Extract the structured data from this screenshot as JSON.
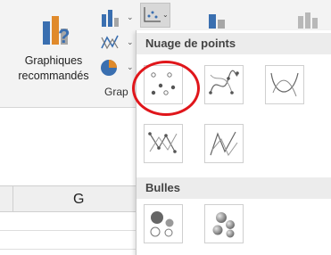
{
  "ribbon": {
    "recommended_label_line1": "Graphiques",
    "recommended_label_line2": "recommandés",
    "group_label": "Grap"
  },
  "dropdown": {
    "scatter_section": "Nuage de points",
    "bubble_section": "Bulles"
  },
  "sheet": {
    "column_letter": "G"
  },
  "colors": {
    "accent_ring": "#e0161b",
    "chart_blue": "#3a6fb0",
    "chart_orange": "#e08a2b",
    "chart_gray": "#7a7a7a"
  }
}
